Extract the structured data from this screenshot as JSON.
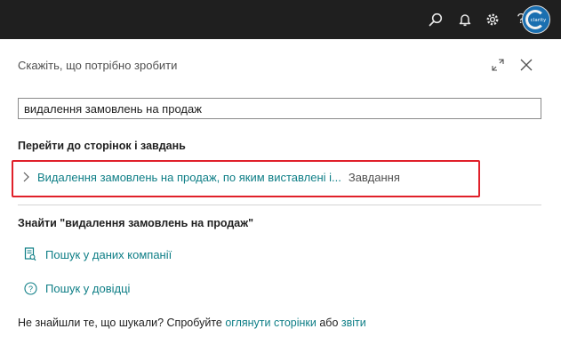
{
  "topbar": {
    "icons": [
      "search-icon",
      "bell-icon",
      "gear-icon",
      "help-icon"
    ],
    "avatar_label": "clarity"
  },
  "tellme": {
    "title": "Скажіть, що потрібно зробити",
    "search_value": "видалення замовлень на продаж"
  },
  "goto_section": {
    "heading": "Перейти до сторінок і завдань",
    "results": [
      {
        "label": "Видалення замовлень на продаж, по яким виставлені і...",
        "category": "Завдання"
      }
    ]
  },
  "find_section": {
    "heading": "Знайти \"видалення замовлень на продаж\"",
    "actions": [
      {
        "label": "Пошук у даних компанії",
        "icon": "database-icon"
      },
      {
        "label": "Пошук у довідці",
        "icon": "help-circle-icon"
      }
    ]
  },
  "footer": {
    "prefix": "Не знайшли те, що шукали? Спробуйте ",
    "link1": "оглянути сторінки",
    "middle": " або ",
    "link2": "звіти"
  },
  "colors": {
    "topbar": "#1f1f1f",
    "accent": "#0e7e86",
    "highlight_border": "#e0202a"
  }
}
